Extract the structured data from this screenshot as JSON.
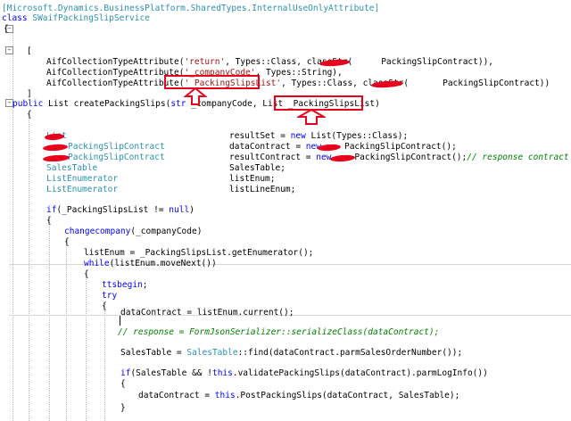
{
  "code": {
    "l1": "[Microsoft.Dynamics.BusinessPlatform.SharedTypes.InternalUseOnlyAttribute]",
    "kw_class": "class",
    "class_name": "SWaifPackingSlipService",
    "brace_open": "{",
    "brace_close": "}",
    "bracket_open": "[",
    "bracket_close": "]",
    "attr1_a": "AifCollectionTypeAttribute(",
    "attr1_str": "'return'",
    "attr1_b": ", Types::Class, classStr(",
    "attr1_c": "PackingSlipContract)),",
    "attr2_a": "AifCollectionTypeAttribute(",
    "attr2_str": "'_companyCode'",
    "attr2_b": ", Types::String),",
    "attr3_a": "AifCollectionTypeAttribute(",
    "attr3_str": "'_PackingSlipsList'",
    "attr3_b": ", Types::Class, classStr(",
    "attr3_c": "PackingSlipContract))",
    "kw_public": "public",
    "method_a": " List createPackingSlips(",
    "kw_str": "str",
    "method_b": " _companyCode, List ",
    "method_param": "_PackingSlipsList)",
    "decl_list": "List",
    "decl_resultset": "resultSet = ",
    "kw_new": "new",
    "decl_list_ctor": " List(",
    "decl_types_class": "Types::Class);",
    "decl_psc1": "PackingSlipContract",
    "decl_datacontract": "dataContract = ",
    "decl_psc_ctor": "PackingSlipContract();",
    "decl_psc2": "PackingSlipContract",
    "decl_resultcontract": "resultContract = ",
    "decl_psc_ctor2": "PackingSlipContract();",
    "cm_response_contract": "// response contract",
    "decl_salestable_type": "SalesTable",
    "decl_salestable_var": "SalesTable;",
    "decl_listenum_type": "ListEnumerator",
    "decl_listenum_var": "listEnum;",
    "decl_listenum_type2": "ListEnumerator",
    "decl_listlineenum_var": "listLineEnum;",
    "kw_if": "if",
    "if_cond": "(_PackingSlipsList != ",
    "kw_null": "null",
    "if_close": ")",
    "changecompany": "changecompany",
    "changecompany_arg": "(_companyCode)",
    "listenum_assign": "listEnum = _PackingSlipsList.getEnumerator();",
    "kw_while": "while",
    "while_cond": "(listEnum.moveNext())",
    "kw_ttsbegin": "ttsbegin",
    "ttsbegin_semi": ";",
    "kw_try": "try",
    "datacontract_assign": "dataContract = listEnum.current();",
    "cm_response": "// response = FormJsonSerializer::serializeClass(dataContract);",
    "salestable_assign_a": "SalesTable = ",
    "salestable_assign_type": "SalesTable",
    "salestable_assign_b": "::find(dataContract.parmSalesOrderNumber());",
    "if2_a": "(SalesTable && !",
    "kw_this": "this",
    "if2_b": ".validatePackingSlips(dataContract).parmLogInfo())",
    "datacontract_assign2_a": "dataContract = ",
    "kw_this2": "this",
    "datacontract_assign2_b": ".PostPackingSlips(dataContract, SalesTable);"
  },
  "colors": {
    "keyword": "#0000ff",
    "type": "#2b91af",
    "string": "#a31515",
    "comment": "#008000",
    "annotation_red": "#e8001c"
  },
  "icons": {
    "fold": "collapse-minus-icon",
    "arrow": "red-up-arrow-icon"
  }
}
